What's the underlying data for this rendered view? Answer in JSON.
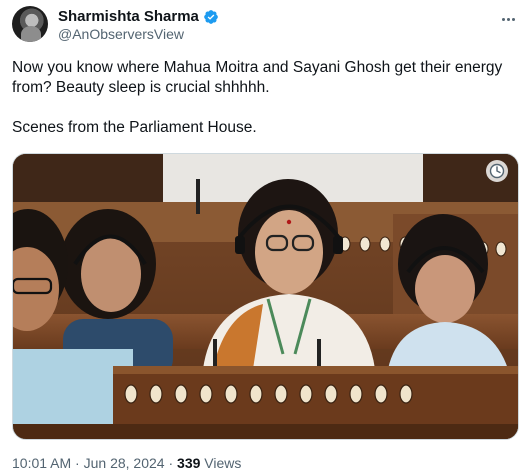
{
  "author": {
    "display_name": "Sharmishta Sharma",
    "handle": "@AnObserversView",
    "verified": true,
    "verified_color": "#1d9bf0"
  },
  "tweet": {
    "text": "Now you know where Mahua Moitra and Sayani Ghosh get their energy from? Beauty sleep is crucial shhhhh.\n\nScenes from the Parliament House."
  },
  "media": {
    "icons": [
      "clock-icon"
    ]
  },
  "meta": {
    "time": "10:01 AM",
    "separator": "·",
    "date": "Jun 28, 2024",
    "views_count": "339",
    "views_label": "Views"
  },
  "icons": [
    "verified-badge-icon",
    "more-options-icon",
    "clock-icon"
  ]
}
